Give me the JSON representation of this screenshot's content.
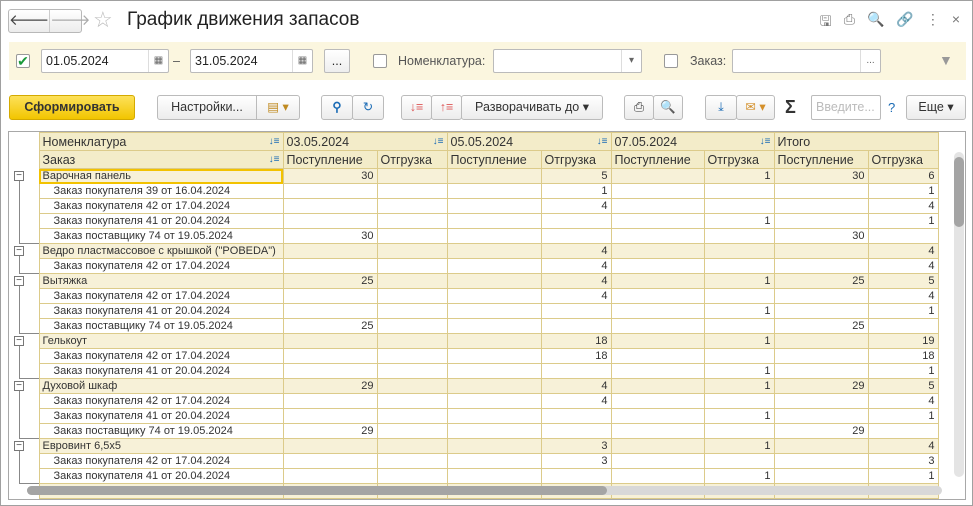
{
  "header": {
    "title": "График движения запасов",
    "back": "🡐",
    "forward": "🡒"
  },
  "filter": {
    "period_enabled": true,
    "date_from": "01.05.2024",
    "dash": "–",
    "date_to": "31.05.2024",
    "more": "...",
    "nomenclature_label": "Номенклатура:",
    "nomenclature_value": "",
    "order_label": "Заказ:",
    "order_value": ""
  },
  "toolbar": {
    "generate": "Сформировать",
    "settings": "Настройки...",
    "expand_to": "Разворачивать до",
    "search_placeholder": "Введите...",
    "help": "?",
    "more": "Еще",
    "sigma": "Σ"
  },
  "table": {
    "headers_row1": [
      "Номенклатура",
      "03.05.2024",
      "05.05.2024",
      "07.05.2024",
      "Итого"
    ],
    "headers_row2": [
      "Заказ",
      "Поступление",
      "Отгрузка",
      "Поступление",
      "Отгрузка",
      "Поступление",
      "Отгрузка",
      "Поступление",
      "Отгрузка"
    ],
    "rows": [
      {
        "level": 0,
        "name": "Варочная панель",
        "v": [
          "30",
          "",
          "",
          "5",
          "",
          "1",
          "30",
          "6"
        ]
      },
      {
        "level": 1,
        "name": "Заказ покупателя 39 от 16.04.2024",
        "v": [
          "",
          "",
          "",
          "1",
          "",
          "",
          "",
          "1"
        ]
      },
      {
        "level": 1,
        "name": "Заказ покупателя 42 от 17.04.2024",
        "v": [
          "",
          "",
          "",
          "4",
          "",
          "",
          "",
          "4"
        ]
      },
      {
        "level": 1,
        "name": "Заказ покупателя 41 от 20.04.2024",
        "v": [
          "",
          "",
          "",
          "",
          "",
          "1",
          "",
          "1"
        ]
      },
      {
        "level": 1,
        "name": "Заказ поставщику 74 от 19.05.2024",
        "v": [
          "30",
          "",
          "",
          "",
          "",
          "",
          "30",
          ""
        ]
      },
      {
        "level": 0,
        "name": "Ведро пластмассовое с крышкой (\"POBEDA\")",
        "v": [
          "",
          "",
          "",
          "4",
          "",
          "",
          "",
          "4"
        ]
      },
      {
        "level": 1,
        "name": "Заказ покупателя 42 от 17.04.2024",
        "v": [
          "",
          "",
          "",
          "4",
          "",
          "",
          "",
          "4"
        ]
      },
      {
        "level": 0,
        "name": "Вытяжка",
        "v": [
          "25",
          "",
          "",
          "4",
          "",
          "1",
          "25",
          "5"
        ]
      },
      {
        "level": 1,
        "name": "Заказ покупателя 42 от 17.04.2024",
        "v": [
          "",
          "",
          "",
          "4",
          "",
          "",
          "",
          "4"
        ]
      },
      {
        "level": 1,
        "name": "Заказ покупателя 41 от 20.04.2024",
        "v": [
          "",
          "",
          "",
          "",
          "",
          "1",
          "",
          "1"
        ]
      },
      {
        "level": 1,
        "name": "Заказ поставщику 74 от 19.05.2024",
        "v": [
          "25",
          "",
          "",
          "",
          "",
          "",
          "25",
          ""
        ]
      },
      {
        "level": 0,
        "name": "Гелькоут",
        "v": [
          "",
          "",
          "",
          "18",
          "",
          "1",
          "",
          "19"
        ]
      },
      {
        "level": 1,
        "name": "Заказ покупателя 42 от 17.04.2024",
        "v": [
          "",
          "",
          "",
          "18",
          "",
          "",
          "",
          "18"
        ]
      },
      {
        "level": 1,
        "name": "Заказ покупателя 41 от 20.04.2024",
        "v": [
          "",
          "",
          "",
          "",
          "",
          "1",
          "",
          "1"
        ]
      },
      {
        "level": 0,
        "name": "Духовой шкаф",
        "v": [
          "29",
          "",
          "",
          "4",
          "",
          "1",
          "29",
          "5"
        ]
      },
      {
        "level": 1,
        "name": "Заказ покупателя 42 от 17.04.2024",
        "v": [
          "",
          "",
          "",
          "4",
          "",
          "",
          "",
          "4"
        ]
      },
      {
        "level": 1,
        "name": "Заказ покупателя 41 от 20.04.2024",
        "v": [
          "",
          "",
          "",
          "",
          "",
          "1",
          "",
          "1"
        ]
      },
      {
        "level": 1,
        "name": "Заказ поставщику 74 от 19.05.2024",
        "v": [
          "29",
          "",
          "",
          "",
          "",
          "",
          "29",
          ""
        ]
      },
      {
        "level": 0,
        "name": "Евровинт 6,5x5",
        "v": [
          "",
          "",
          "",
          "3",
          "",
          "1",
          "",
          "4"
        ]
      },
      {
        "level": 1,
        "name": "Заказ покупателя 42 от 17.04.2024",
        "v": [
          "",
          "",
          "",
          "3",
          "",
          "",
          "",
          "3"
        ]
      },
      {
        "level": 1,
        "name": "Заказ покупателя 41 от 20.04.2024",
        "v": [
          "",
          "",
          "",
          "",
          "",
          "1",
          "",
          "1"
        ]
      },
      {
        "level": 0,
        "name": "",
        "v": [
          "",
          "",
          "",
          "",
          "",
          "",
          "",
          ""
        ]
      }
    ]
  }
}
